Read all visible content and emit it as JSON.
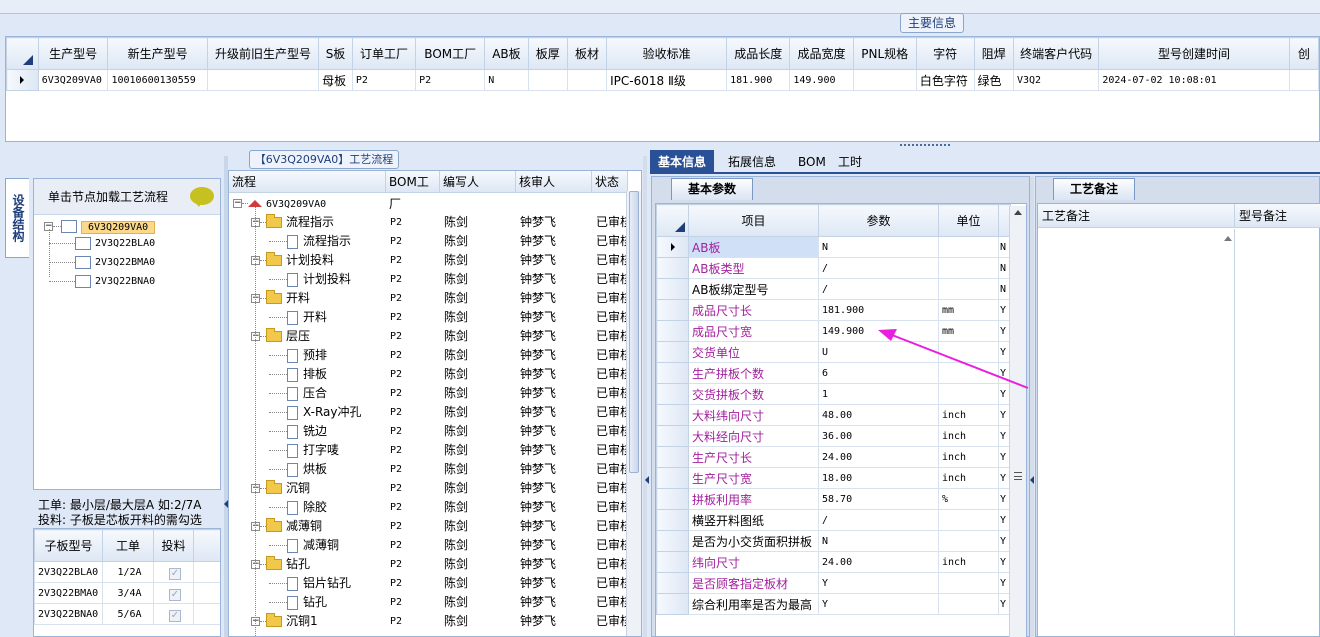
{
  "top": {
    "main_info_label": "主要信息",
    "columns": [
      "生产型号",
      "新生产型号",
      "升级前旧生产型号",
      "S板",
      "订单工厂",
      "BOM工厂",
      "AB板",
      "板厚",
      "板材",
      "验收标准",
      "成品长度",
      "成品宽度",
      "PNL规格",
      "字符",
      "阻焊",
      "终端客户代码",
      "型号创建时间",
      "创"
    ],
    "row": [
      "6V3Q209VA0",
      "10010600130559",
      "",
      "母板",
      "P2",
      "P2",
      "N",
      "",
      "",
      "IPC-6018 Ⅱ级",
      "181.900",
      "149.900",
      "",
      "白色字符",
      "绿色",
      "V3Q2",
      "2024-07-02 10:08:01",
      ""
    ]
  },
  "sidebar": {
    "vertical_tab": "设备结构",
    "hint": "单击节点加载工艺流程",
    "tree": {
      "root": "6V3Q209VA0",
      "children": [
        "2V3Q22BLA0",
        "2V3Q22BMA0",
        "2V3Q22BNA0"
      ]
    },
    "layer_note_line1": "工单: 最小层/最大层A 如:2/7A",
    "layer_note_line2": "投料: 子板是芯板开料的需勾选",
    "sub_grid": {
      "columns": [
        "子板型号",
        "工单",
        "投料"
      ],
      "rows": [
        {
          "model": "2V3Q22BLA0",
          "order": "1/2A",
          "check": "✓"
        },
        {
          "model": "2V3Q22BMA0",
          "order": "3/4A",
          "check": "✓"
        },
        {
          "model": "2V3Q22BNA0",
          "order": "5/6A",
          "check": "✓"
        }
      ]
    }
  },
  "process": {
    "title": "【6V3Q209VA0】工艺流程",
    "columns": [
      "流程",
      "BOM工厂",
      "编写人",
      "核审人",
      "状态"
    ],
    "root": "6V3Q209VA0",
    "rows": [
      {
        "name": "流程指示",
        "level": 1,
        "folder": true,
        "bom": "P2",
        "writer": "陈剑",
        "reviewer": "钟梦飞",
        "status": "已审核"
      },
      {
        "name": "流程指示",
        "level": 2,
        "folder": false,
        "bom": "P2",
        "writer": "陈剑",
        "reviewer": "钟梦飞",
        "status": "已审核"
      },
      {
        "name": "计划投料",
        "level": 1,
        "folder": true,
        "bom": "P2",
        "writer": "陈剑",
        "reviewer": "钟梦飞",
        "status": "已审核"
      },
      {
        "name": "计划投料",
        "level": 2,
        "folder": false,
        "bom": "P2",
        "writer": "陈剑",
        "reviewer": "钟梦飞",
        "status": "已审核"
      },
      {
        "name": "开料",
        "level": 1,
        "folder": true,
        "bom": "P2",
        "writer": "陈剑",
        "reviewer": "钟梦飞",
        "status": "已审核"
      },
      {
        "name": "开料",
        "level": 2,
        "folder": false,
        "bom": "P2",
        "writer": "陈剑",
        "reviewer": "钟梦飞",
        "status": "已审核"
      },
      {
        "name": "层压",
        "level": 1,
        "folder": true,
        "bom": "P2",
        "writer": "陈剑",
        "reviewer": "钟梦飞",
        "status": "已审核"
      },
      {
        "name": "预排",
        "level": 2,
        "folder": false,
        "bom": "P2",
        "writer": "陈剑",
        "reviewer": "钟梦飞",
        "status": "已审核"
      },
      {
        "name": "排板",
        "level": 2,
        "folder": false,
        "bom": "P2",
        "writer": "陈剑",
        "reviewer": "钟梦飞",
        "status": "已审核"
      },
      {
        "name": "压合",
        "level": 2,
        "folder": false,
        "bom": "P2",
        "writer": "陈剑",
        "reviewer": "钟梦飞",
        "status": "已审核"
      },
      {
        "name": "X-Ray冲孔",
        "level": 2,
        "folder": false,
        "bom": "P2",
        "writer": "陈剑",
        "reviewer": "钟梦飞",
        "status": "已审核"
      },
      {
        "name": "铣边",
        "level": 2,
        "folder": false,
        "bom": "P2",
        "writer": "陈剑",
        "reviewer": "钟梦飞",
        "status": "已审核"
      },
      {
        "name": "打字唛",
        "level": 2,
        "folder": false,
        "bom": "P2",
        "writer": "陈剑",
        "reviewer": "钟梦飞",
        "status": "已审核"
      },
      {
        "name": "烘板",
        "level": 2,
        "folder": false,
        "bom": "P2",
        "writer": "陈剑",
        "reviewer": "钟梦飞",
        "status": "已审核"
      },
      {
        "name": "沉铜",
        "level": 1,
        "folder": true,
        "bom": "P2",
        "writer": "陈剑",
        "reviewer": "钟梦飞",
        "status": "已审核"
      },
      {
        "name": "除胶",
        "level": 2,
        "folder": false,
        "bom": "P2",
        "writer": "陈剑",
        "reviewer": "钟梦飞",
        "status": "已审核"
      },
      {
        "name": "减薄铜",
        "level": 1,
        "folder": true,
        "bom": "P2",
        "writer": "陈剑",
        "reviewer": "钟梦飞",
        "status": "已审核"
      },
      {
        "name": "减薄铜",
        "level": 2,
        "folder": false,
        "bom": "P2",
        "writer": "陈剑",
        "reviewer": "钟梦飞",
        "status": "已审核"
      },
      {
        "name": "钻孔",
        "level": 1,
        "folder": true,
        "bom": "P2",
        "writer": "陈剑",
        "reviewer": "钟梦飞",
        "status": "已审核"
      },
      {
        "name": "铝片钻孔",
        "level": 2,
        "folder": false,
        "bom": "P2",
        "writer": "陈剑",
        "reviewer": "钟梦飞",
        "status": "已审核"
      },
      {
        "name": "钻孔",
        "level": 2,
        "folder": false,
        "bom": "P2",
        "writer": "陈剑",
        "reviewer": "钟梦飞",
        "status": "已审核"
      },
      {
        "name": "沉铜1",
        "level": 1,
        "folder": true,
        "bom": "P2",
        "writer": "陈剑",
        "reviewer": "钟梦飞",
        "status": "已审核"
      }
    ]
  },
  "right_tabs": [
    "基本信息",
    "拓展信息",
    "BOM",
    "工时"
  ],
  "basic": {
    "tab_label": "基本参数",
    "columns": [
      "项目",
      "参数",
      "单位"
    ],
    "rows": [
      {
        "item": "AB板",
        "param": "N",
        "unit": "",
        "flag": "N",
        "pink": true
      },
      {
        "item": "AB板类型",
        "param": "/",
        "unit": "",
        "flag": "N",
        "pink": true
      },
      {
        "item": "AB板绑定型号",
        "param": "/",
        "unit": "",
        "flag": "N",
        "pink": false
      },
      {
        "item": "成品尺寸长",
        "param": "181.900",
        "unit": "mm",
        "flag": "Y",
        "pink": true
      },
      {
        "item": "成品尺寸宽",
        "param": "149.900",
        "unit": "mm",
        "flag": "Y",
        "pink": true
      },
      {
        "item": "交货单位",
        "param": "U",
        "unit": "",
        "flag": "Y",
        "pink": true
      },
      {
        "item": "生产拼板个数",
        "param": "6",
        "unit": "",
        "flag": "Y",
        "pink": true
      },
      {
        "item": "交货拼板个数",
        "param": "1",
        "unit": "",
        "flag": "Y",
        "pink": true
      },
      {
        "item": "大料纬向尺寸",
        "param": "48.00",
        "unit": "inch",
        "flag": "Y",
        "pink": true
      },
      {
        "item": "大料经向尺寸",
        "param": "36.00",
        "unit": "inch",
        "flag": "Y",
        "pink": true
      },
      {
        "item": "生产尺寸长",
        "param": "24.00",
        "unit": "inch",
        "flag": "Y",
        "pink": true
      },
      {
        "item": "生产尺寸宽",
        "param": "18.00",
        "unit": "inch",
        "flag": "Y",
        "pink": true
      },
      {
        "item": "拼板利用率",
        "param": "58.70",
        "unit": "%",
        "flag": "Y",
        "pink": true
      },
      {
        "item": "横竖开料图纸",
        "param": "/",
        "unit": "",
        "flag": "Y",
        "pink": false
      },
      {
        "item": "是否为小交货面积拼板",
        "param": "N",
        "unit": "",
        "flag": "Y",
        "pink": false
      },
      {
        "item": "纬向尺寸",
        "param": "24.00",
        "unit": "inch",
        "flag": "Y",
        "pink": true
      },
      {
        "item": "是否顾客指定板材",
        "param": "Y",
        "unit": "",
        "flag": "Y",
        "pink": true
      },
      {
        "item": "综合利用率是否为最高",
        "param": "Y",
        "unit": "",
        "flag": "Y",
        "pink": false
      }
    ]
  },
  "remark": {
    "tab_label": "工艺备注",
    "col1": "工艺备注",
    "col2": "型号备注"
  },
  "colors": {
    "accent": "#2a5196",
    "pink_text": "#a3209e",
    "annotation_arrow": "#e81ee0"
  }
}
